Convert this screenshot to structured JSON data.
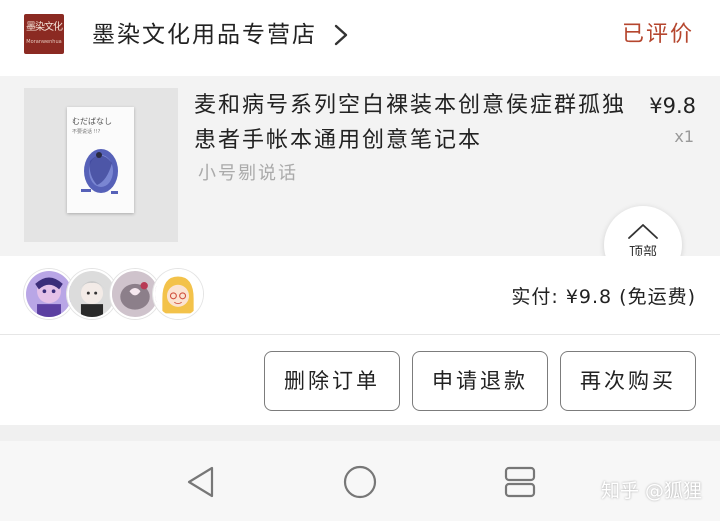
{
  "store": {
    "logo_text_top": "墨染文化",
    "logo_text_bottom": "Moranwenhua",
    "name": "墨染文化用品专营店",
    "review_status": "已评价"
  },
  "product": {
    "title": "麦和病号系列空白裸装本创意侯症群孤独患者手帐本通用创意笔记本",
    "price": "¥9.8",
    "quantity": "x1",
    "spec": "小号剔说话",
    "thumbnail": {
      "cover_title": "むだばなし",
      "cover_subtitle": "不要说话 !!?"
    }
  },
  "back_to_top": {
    "label": "顶部",
    "icon": "caret-up-icon"
  },
  "order": {
    "paid_summary": "实付: ¥9.8 (免运费)",
    "avatars": [
      "avatar-1",
      "avatar-2",
      "avatar-3",
      "avatar-4"
    ]
  },
  "actions": {
    "delete": "删除订单",
    "refund": "申请退款",
    "rebuy": "再次购买"
  },
  "nav": {
    "back_icon": "triangle-back-icon",
    "home_icon": "circle-home-icon",
    "recents_icon": "square-recents-icon"
  },
  "watermark": "知乎 @狐狸",
  "colors": {
    "accent": "#b5462e",
    "logo_bg": "#8b2a22",
    "card_bg": "#f3f3f3",
    "price_text": "#222222",
    "muted_text": "#aaaaaa"
  }
}
